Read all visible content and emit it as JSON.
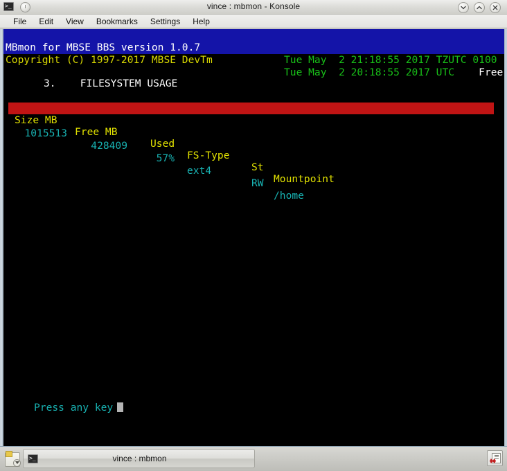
{
  "window": {
    "title": "vince : mbmon - Konsole",
    "app_icon": "terminal-icon",
    "pin_icon": "pin-button-icon",
    "controls": {
      "minimize": "minimize-icon",
      "maximize": "maximize-icon",
      "close": "close-icon"
    }
  },
  "menubar": {
    "items": [
      {
        "label": "File"
      },
      {
        "label": "Edit"
      },
      {
        "label": "View"
      },
      {
        "label": "Bookmarks"
      },
      {
        "label": "Settings"
      },
      {
        "label": "Help"
      }
    ]
  },
  "terminal": {
    "banner": {
      "line1_left": "MBmon for MBSE BBS version 1.0.7",
      "line1_right": "Tue May  2 21:18:55 2017 TZUTC 0100",
      "line2_left": "Copyright (C) 1997-2017 MBSE DevTm",
      "line2_right_date": "Tue May  2 20:18:55 2017 UTC",
      "line2_right_status": "Free"
    },
    "section": {
      "number": "3.",
      "title": "FILESYSTEM USAGE"
    },
    "table": {
      "headers": {
        "size": "Size MB",
        "free": "Free MB",
        "used": "Used",
        "fstype": "FS-Type",
        "st": "St",
        "mountpoint": "Mountpoint"
      },
      "rows": [
        {
          "size": "1015513",
          "free": "428409",
          "used": "57%",
          "fstype": "ext4",
          "st": "RW",
          "mountpoint": "/home"
        }
      ]
    },
    "prompt": "Press any key",
    "colors": {
      "banner_bg": "#1414a8",
      "table_header_bg": "#c01414",
      "table_header_fg": "#e0e000",
      "data_fg": "#18b2b2",
      "date_fg": "#18c018",
      "copyright_fg": "#d8d800"
    }
  },
  "taskbar": {
    "launcher_icon": "show-desktop-icon",
    "task_icon": "terminal-icon",
    "task_label": "vince : mbmon",
    "tray_icon": "clipboard-icon"
  }
}
